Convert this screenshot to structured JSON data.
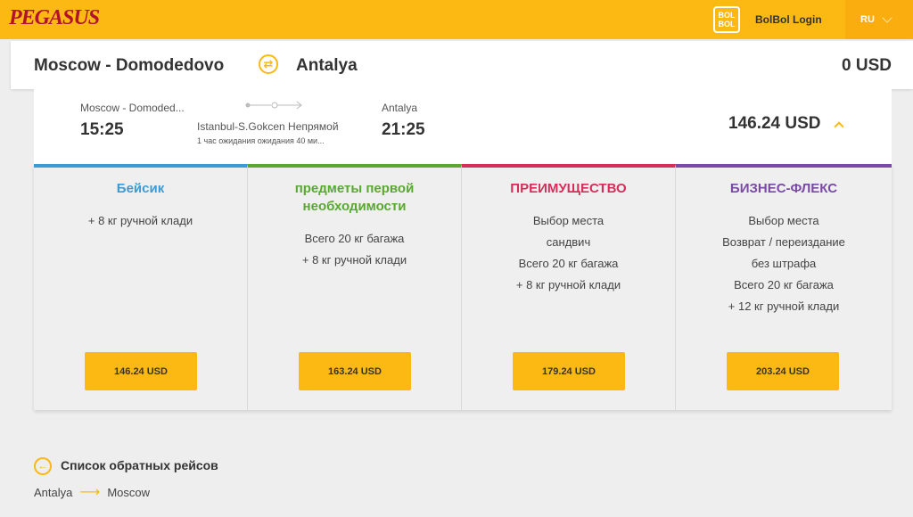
{
  "header": {
    "logo": "PEGASUS",
    "bolbol_badge": "BOL BOL",
    "bolbol_login": "BolBol Login",
    "language": "RU"
  },
  "route": {
    "from": "Moscow - Domodedovo",
    "to": "Antalya",
    "total": "0 USD"
  },
  "flight": {
    "departure_city": "Moscow - Domoded...",
    "departure_time": "15:25",
    "stopover": "Istanbul-S.Gokcen Непрямой",
    "wait": "1 час ожидания ожидания 40 ми...",
    "arrival_city": "Antalya",
    "arrival_time": "21:25",
    "price": "146.24 USD"
  },
  "fares": [
    {
      "name": "Бейсик",
      "color": "#3b9bd4",
      "features": [
        "+ 8 кг ручной клади"
      ],
      "price": "146.24 USD"
    },
    {
      "name": "предметы первой необходимости",
      "color": "#5aa832",
      "features": [
        "Всего 20 кг багажа",
        "+ 8 кг ручной клади"
      ],
      "price": "163.24 USD"
    },
    {
      "name": "ПРЕИМУЩЕСТВО",
      "color": "#d62d5a",
      "features": [
        "Выбор места",
        "сандвич",
        "Всего 20 кг багажа",
        "+ 8 кг ручной клади"
      ],
      "price": "179.24 USD"
    },
    {
      "name": "БИЗНЕС-ФЛЕКС",
      "color": "#7b4aa8",
      "features": [
        "Выбор места",
        "Возврат / переиздание",
        "без штрафа",
        "Всего 20 кг багажа",
        "+ 12 кг ручной клади"
      ],
      "price": "203.24 USD"
    }
  ],
  "return_flights": {
    "title": "Список обратных рейсов",
    "from": "Antalya",
    "to": "Moscow"
  }
}
